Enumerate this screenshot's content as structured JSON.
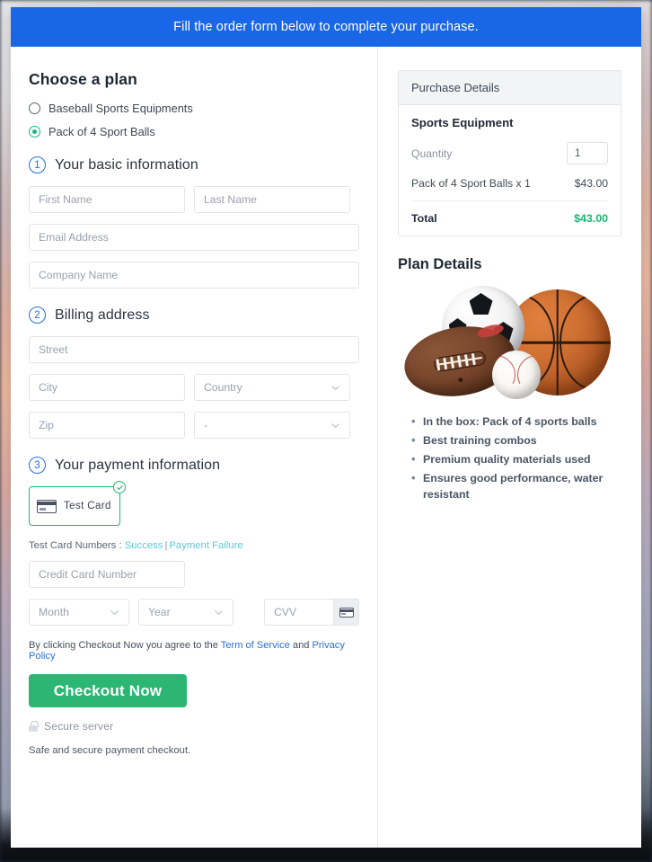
{
  "banner": {
    "text": "Fill the order form below to complete your purchase."
  },
  "plan": {
    "heading": "Choose a plan",
    "options": [
      {
        "label": "Baseball Sports Equipments",
        "selected": false
      },
      {
        "label": "Pack of 4 Sport Balls",
        "selected": true
      }
    ]
  },
  "steps": {
    "basic": {
      "number": "1",
      "title": "Your basic information"
    },
    "billing": {
      "number": "2",
      "title": "Billing address"
    },
    "payment": {
      "number": "3",
      "title": "Your payment information"
    }
  },
  "basic_fields": {
    "first_name": {
      "placeholder": "First Name",
      "value": ""
    },
    "last_name": {
      "placeholder": "Last Name",
      "value": ""
    },
    "email": {
      "placeholder": "Email Address",
      "value": ""
    },
    "company": {
      "placeholder": "Company Name",
      "value": ""
    }
  },
  "billing_fields": {
    "street": {
      "placeholder": "Street",
      "value": ""
    },
    "city": {
      "placeholder": "City",
      "value": ""
    },
    "country": {
      "placeholder": "Country",
      "value": ""
    },
    "zip": {
      "placeholder": "Zip",
      "value": ""
    },
    "state": {
      "placeholder": "-",
      "value": "-"
    }
  },
  "payment": {
    "method_label": "Test  Card",
    "method_icon": "credit-card-icon",
    "method_selected": true,
    "test_numbers_label": "Test Card Numbers :",
    "link_success": "Success",
    "link_separator": "|",
    "link_failure": "Payment Failure",
    "card_number": {
      "placeholder": "Credit Card Number",
      "value": ""
    },
    "month": {
      "placeholder": "Month",
      "value": ""
    },
    "year": {
      "placeholder": "Year",
      "value": ""
    },
    "cvv": {
      "placeholder": "CVV",
      "value": ""
    },
    "cvv_icon": "credit-card-icon"
  },
  "footer": {
    "terms_prefix": "By clicking Checkout Now you agree to the ",
    "terms_link": "Term of Service",
    "terms_middle": " and ",
    "privacy_link": "Privacy Policy",
    "checkout_button": "Checkout Now",
    "secure_label": "Secure server",
    "secure_icon": "lock-icon",
    "safe_note": "Safe and secure payment checkout."
  },
  "purchase": {
    "header": "Purchase Details",
    "product_title": "Sports Equipment",
    "quantity_label": "Quantity",
    "quantity_value": "1",
    "line_item_label": "Pack of 4 Sport Balls x 1",
    "line_item_price": "$43.00",
    "total_label": "Total",
    "total_price": "$43.00"
  },
  "plan_details": {
    "heading": "Plan Details",
    "image_alt": "sports-balls-image",
    "features": [
      "In the box: Pack of 4 sports balls",
      "Best training combos",
      "Premium quality materials used",
      "Ensures good performance, water resistant"
    ]
  },
  "colors": {
    "banner_blue": "#1966e6",
    "accent_green": "#2bb673",
    "total_green": "#18b473",
    "step_blue": "#1f6fe0",
    "link_blue": "#2b6fd6",
    "test_link_cyan": "#5bc8d8"
  }
}
